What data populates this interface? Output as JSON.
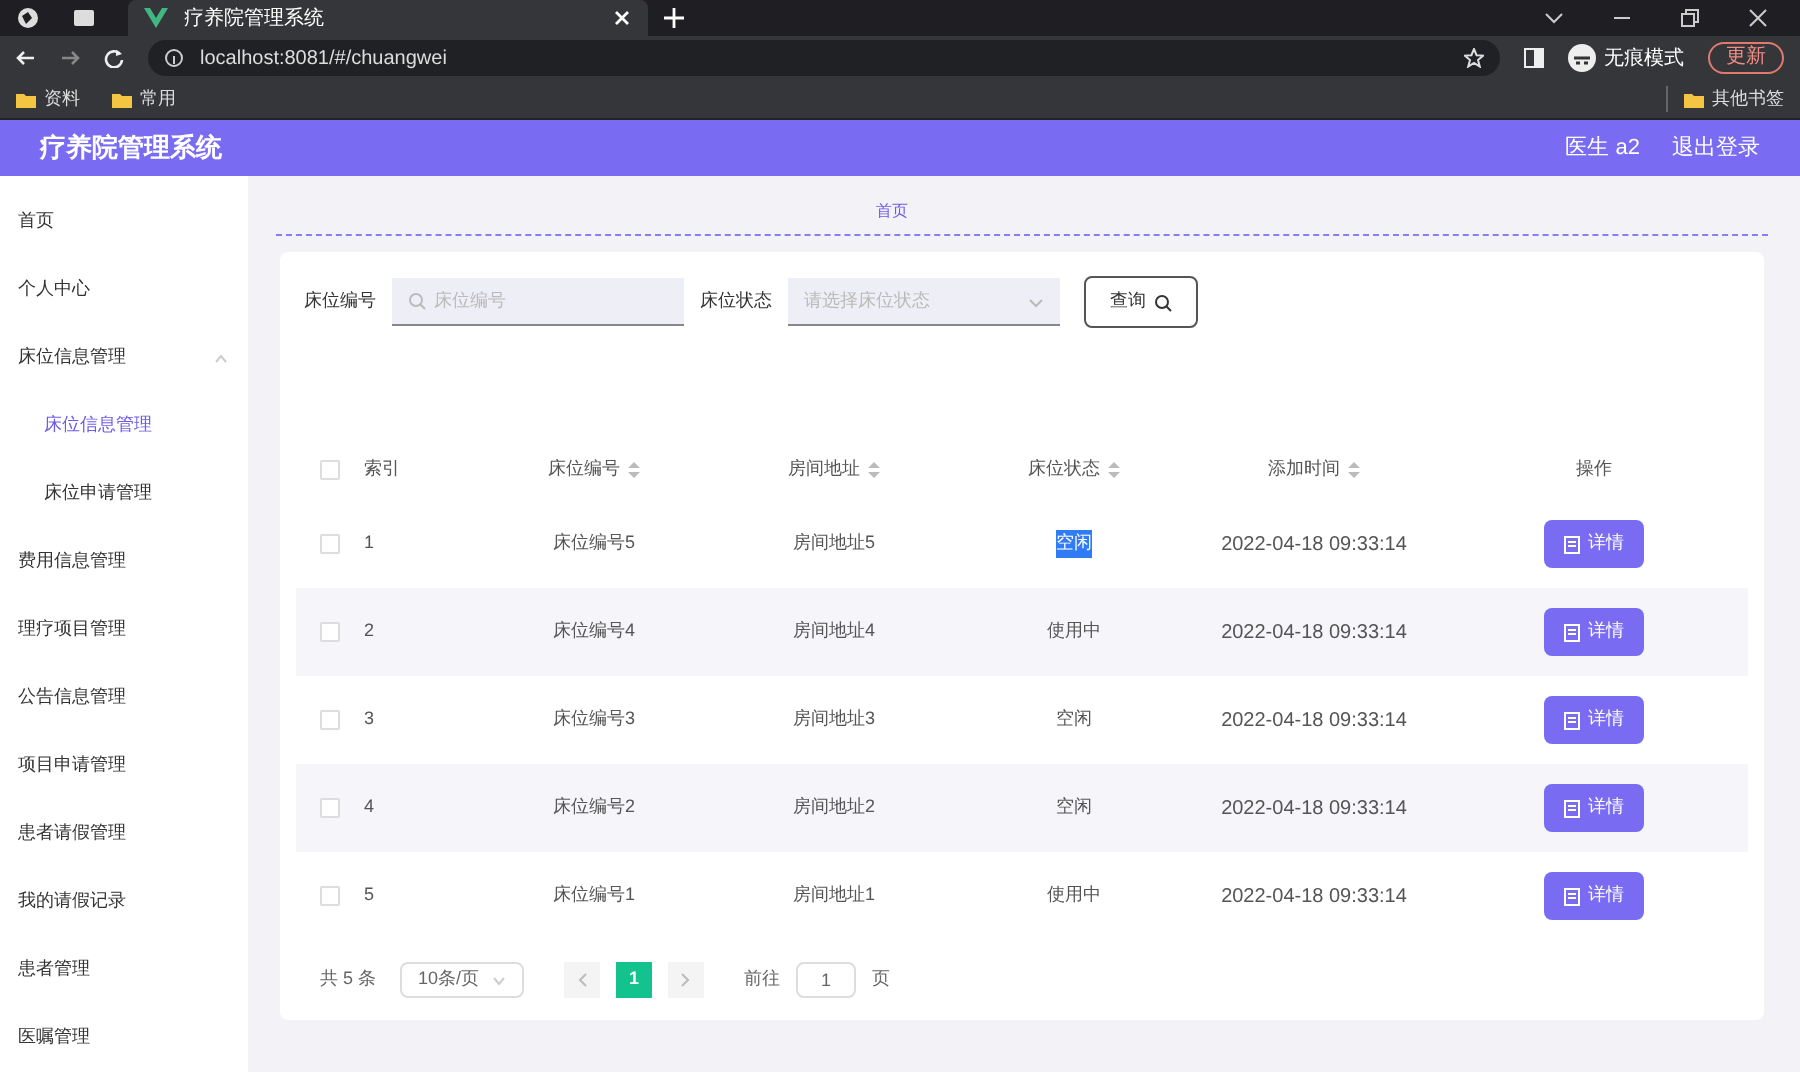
{
  "browser": {
    "tab_title": "疗养院管理系统",
    "url": "localhost:8081/#/chuangwei",
    "profile": "无痕模式",
    "update_button": "更新",
    "bookmarks": [
      "资料",
      "常用"
    ],
    "other_bookmarks": "其他书签"
  },
  "header": {
    "title": "疗养院管理系统",
    "user": "医生 a2",
    "logout": "退出登录"
  },
  "sidebar": {
    "items": [
      {
        "label": "首页",
        "selected": false
      },
      {
        "label": "个人中心",
        "selected": false
      },
      {
        "label": "床位信息管理",
        "selected": false,
        "expanded": true,
        "children": [
          {
            "label": "床位信息管理",
            "selected": true
          },
          {
            "label": "床位申请管理",
            "selected": false
          }
        ]
      },
      {
        "label": "费用信息管理",
        "selected": false
      },
      {
        "label": "理疗项目管理",
        "selected": false
      },
      {
        "label": "公告信息管理",
        "selected": false
      },
      {
        "label": "项目申请管理",
        "selected": false
      },
      {
        "label": "患者请假管理",
        "selected": false
      },
      {
        "label": "我的请假记录",
        "selected": false
      },
      {
        "label": "患者管理",
        "selected": false
      },
      {
        "label": "医嘱管理",
        "selected": false
      }
    ]
  },
  "breadcrumb": [
    "首页"
  ],
  "search": {
    "fields": [
      {
        "label": "床位编号",
        "placeholder": "床位编号",
        "kind": "input"
      },
      {
        "label": "床位状态",
        "placeholder": "请选择床位状态",
        "kind": "select"
      }
    ],
    "button": "查询"
  },
  "table": {
    "select_all_checked": false,
    "columns": [
      "索引",
      "床位编号",
      "房间地址",
      "床位状态",
      "添加时间",
      "操作"
    ],
    "rows": [
      {
        "index": "1",
        "bed": "床位编号5",
        "room": "房间地址5",
        "status": "空闲",
        "status_highlighted": true,
        "time": "2022-04-18 09:33:14",
        "action": "详情",
        "checked": false
      },
      {
        "index": "2",
        "bed": "床位编号4",
        "room": "房间地址4",
        "status": "使用中",
        "status_highlighted": false,
        "time": "2022-04-18 09:33:14",
        "action": "详情",
        "checked": false
      },
      {
        "index": "3",
        "bed": "床位编号3",
        "room": "房间地址3",
        "status": "空闲",
        "status_highlighted": false,
        "time": "2022-04-18 09:33:14",
        "action": "详情",
        "checked": false
      },
      {
        "index": "4",
        "bed": "床位编号2",
        "room": "房间地址2",
        "status": "空闲",
        "status_highlighted": false,
        "time": "2022-04-18 09:33:14",
        "action": "详情",
        "checked": false
      },
      {
        "index": "5",
        "bed": "床位编号1",
        "room": "房间地址1",
        "status": "使用中",
        "status_highlighted": false,
        "time": "2022-04-18 09:33:14",
        "action": "详情",
        "checked": false
      }
    ]
  },
  "pagination": {
    "total": "共 5 条",
    "page_size": "10条/页",
    "pages": [
      {
        "label": "1",
        "selected": true
      }
    ],
    "goto_label": "前往",
    "goto_value": "1",
    "page_unit": "页"
  }
}
